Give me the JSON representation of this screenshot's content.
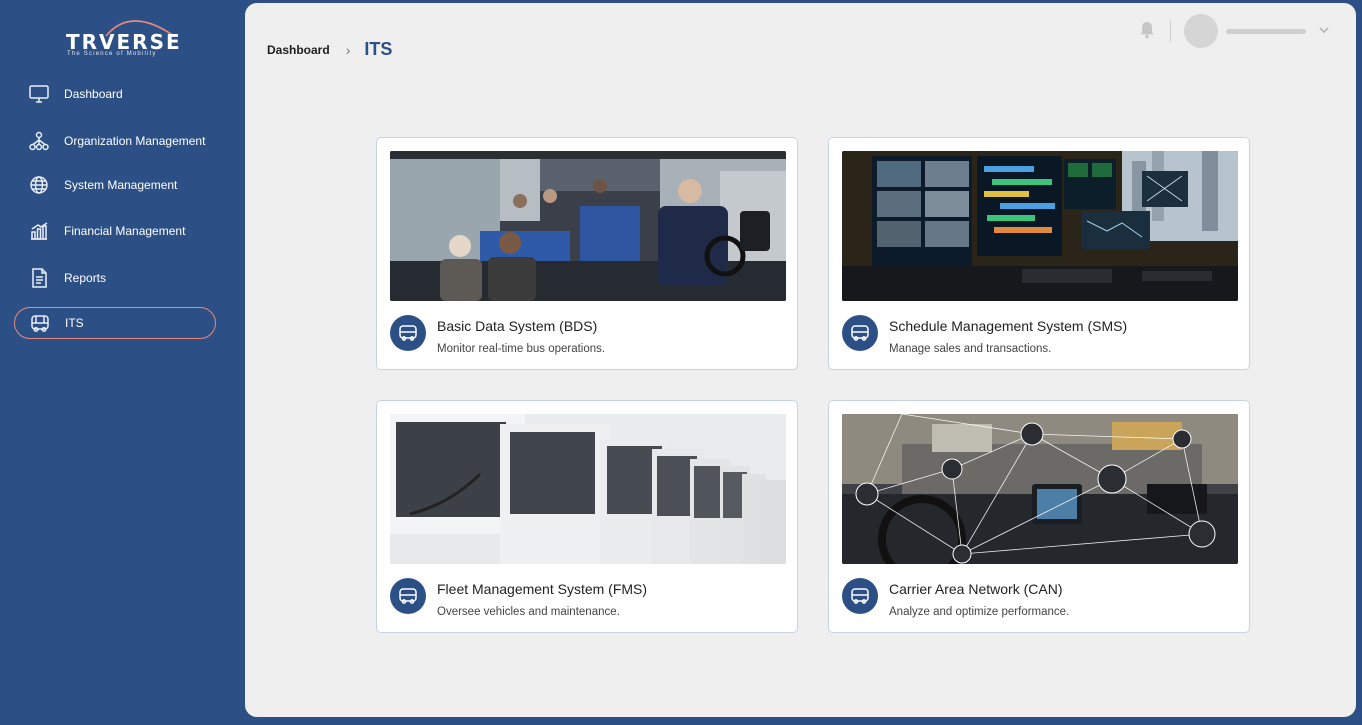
{
  "brand": {
    "name": "TRVERSE",
    "tagline": "The Science of Mobility"
  },
  "sidebar": {
    "items": [
      {
        "label": "Dashboard",
        "icon": "monitor-icon"
      },
      {
        "label": "Organization Management",
        "icon": "org-chart-icon"
      },
      {
        "label": "System Management",
        "icon": "globe-icon"
      },
      {
        "label": "Financial Management",
        "icon": "bar-chart-icon"
      },
      {
        "label": "Reports",
        "icon": "document-icon"
      },
      {
        "label": "ITS",
        "icon": "bus-icon",
        "active": true
      }
    ]
  },
  "breadcrumb": {
    "home": "Dashboard",
    "separator": "›",
    "current": "ITS"
  },
  "header": {
    "bell_icon": "bell-icon",
    "caret_icon": "chevron-down-icon"
  },
  "cards": [
    {
      "title": "Basic Data System (BDS)",
      "desc": "Monitor real-time bus operations.",
      "image": "bus-interior-image"
    },
    {
      "title": "Schedule Management System (SMS)",
      "desc": "Manage sales and transactions.",
      "image": "control-room-image"
    },
    {
      "title": "Fleet Management System (FMS)",
      "desc": "Oversee vehicles and maintenance.",
      "image": "bus-fleet-image"
    },
    {
      "title": "Carrier Area Network (CAN)",
      "desc": "Analyze and optimize performance.",
      "image": "network-dashboard-image"
    }
  ],
  "colors": {
    "primary": "#2c4f86",
    "accent": "#e98a7c",
    "panel": "#efefef"
  }
}
